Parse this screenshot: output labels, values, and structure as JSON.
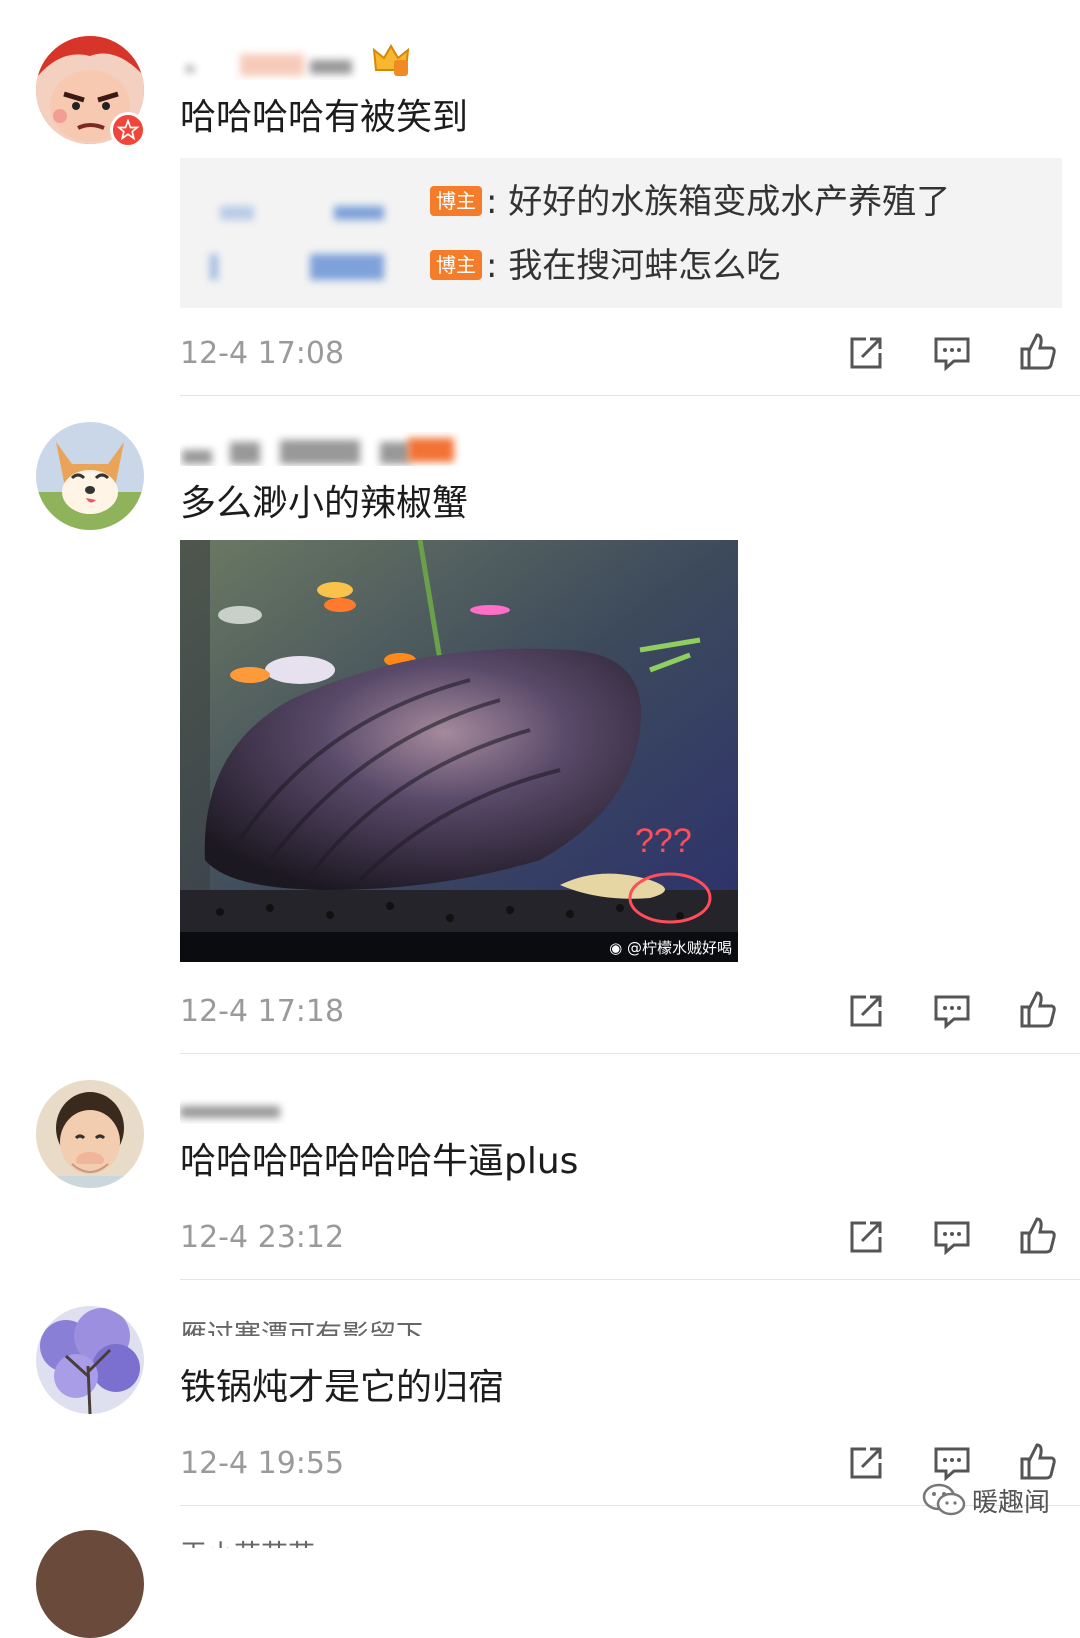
{
  "comments": [
    {
      "text": "哈哈哈哈有被笑到",
      "timestamp": "12-4 17:08",
      "replies": [
        {
          "badge": "博主",
          "text": ": 好好的水族箱变成水产养殖了"
        },
        {
          "badge": "博主",
          "text": ": 我在搜河蚌怎么吃"
        }
      ]
    },
    {
      "text": "多么渺小的辣椒蟹",
      "timestamp": "12-4 17:18",
      "image": {
        "watermark": "@柠檬水贼好喝",
        "annotation": "???"
      }
    },
    {
      "text": "哈哈哈哈哈哈哈牛逼plus",
      "timestamp": "12-4 23:12"
    },
    {
      "username": "雁过寒潭可有影留下",
      "text": "铁锅炖才是它的归宿",
      "timestamp": "12-4 19:55"
    },
    {
      "username": "王小花花花"
    }
  ],
  "watermark": {
    "text": "暖趣闻",
    "icon": "wechat-icon"
  },
  "colors": {
    "badge": "#f57d2a",
    "timestamp": "#9a9a9a",
    "reply_bg": "#f3f3f3",
    "vip": "#f0463a"
  },
  "icons": {
    "share": "share-icon",
    "comment": "comment-icon",
    "like": "thumbs-up-icon"
  }
}
